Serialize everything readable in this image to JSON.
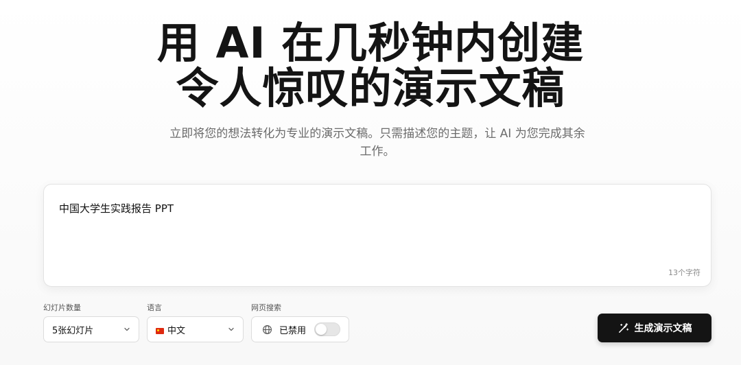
{
  "hero": {
    "title_line1": "用 AI 在几秒钟内创建",
    "title_line2": "令人惊叹的演示文稿",
    "subtitle": "立即将您的想法转化为专业的演示文稿。只需描述您的主题，让 AI 为您完成其余工作。"
  },
  "prompt": {
    "value": "中国大学生实践报告 PPT",
    "char_count": "13个字符"
  },
  "controls": {
    "slides": {
      "label": "幻灯片数量",
      "value": "5张幻灯片"
    },
    "language": {
      "label": "语言",
      "value": "中文"
    },
    "web_search": {
      "label": "网页搜索",
      "state": "已禁用",
      "enabled": false
    }
  },
  "generate_button": {
    "label": "生成演示文稿"
  },
  "colors": {
    "primary_button": "#141414",
    "subtitle_text": "#6b6b6b",
    "flag_red": "#de2910"
  },
  "icons": [
    "chevron-down-icon",
    "china-flag-icon",
    "globe-icon",
    "magic-wand-icon"
  ]
}
